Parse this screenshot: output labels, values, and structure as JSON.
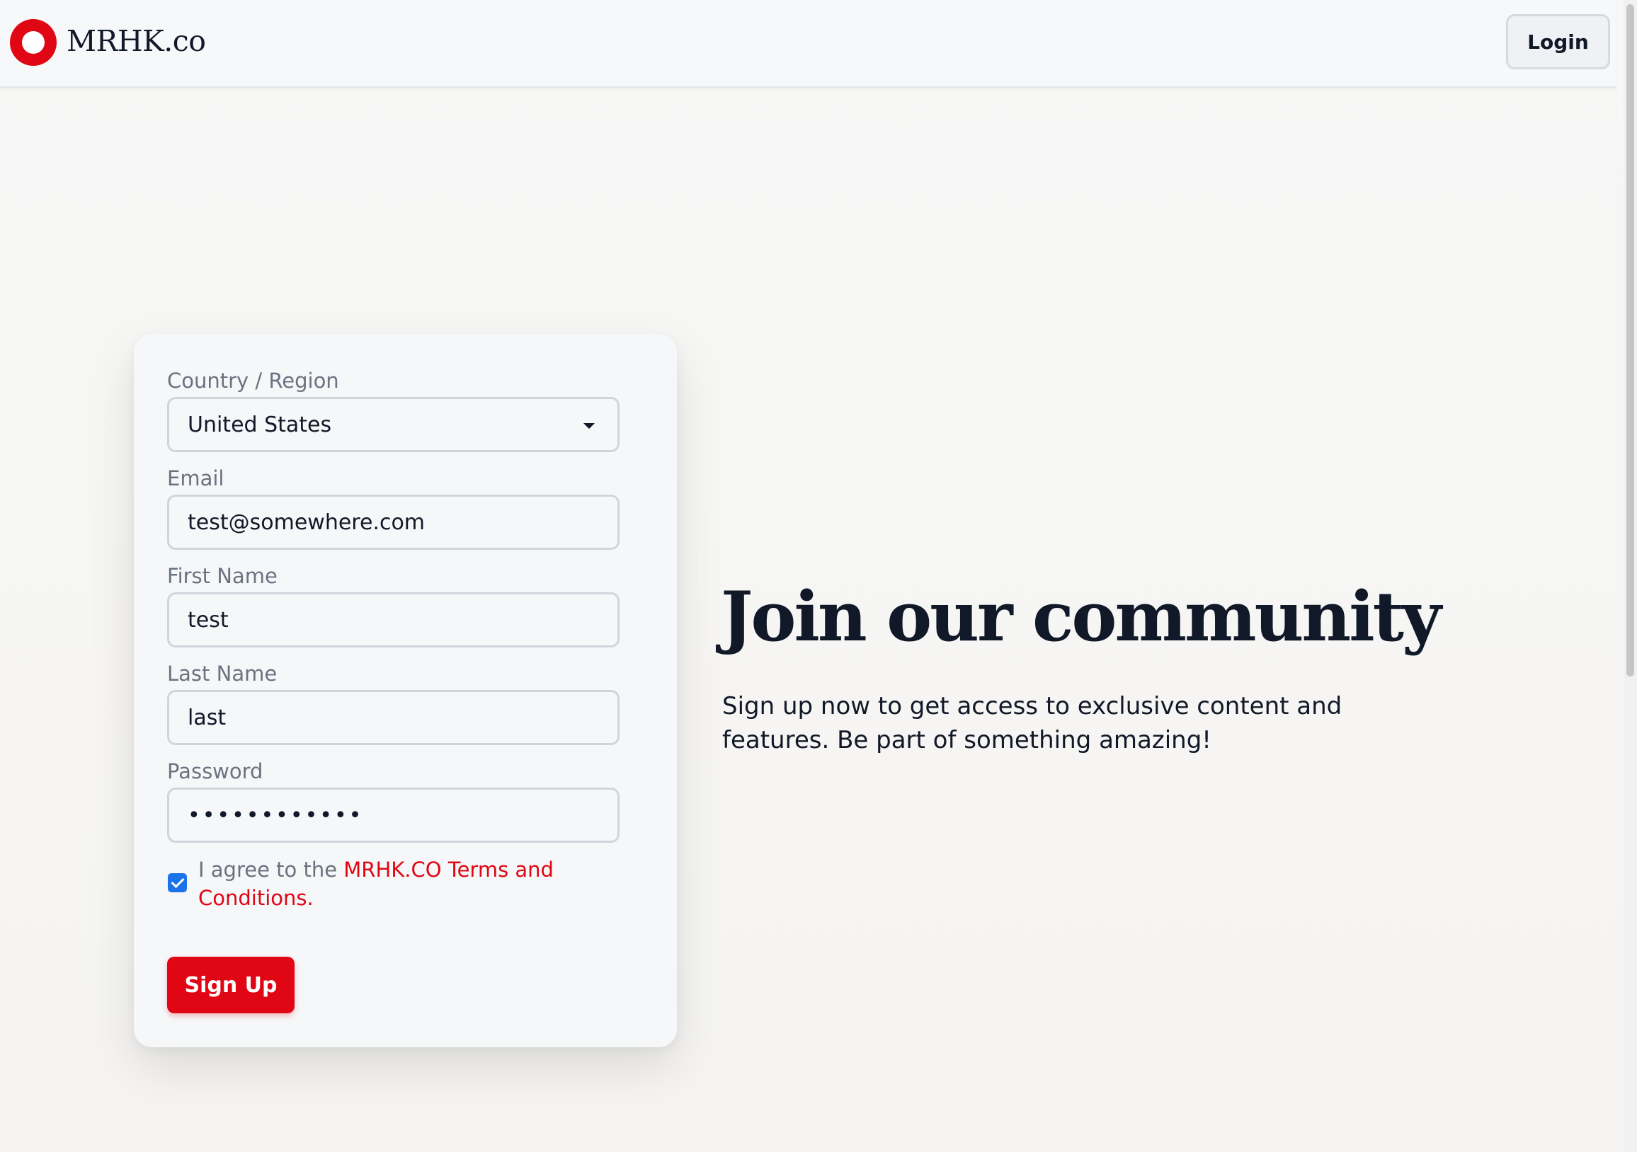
{
  "header": {
    "brand": "MRHK.co",
    "login_label": "Login"
  },
  "form": {
    "country": {
      "label": "Country / Region",
      "value": "United States"
    },
    "email": {
      "label": "Email",
      "value": "test@somewhere.com"
    },
    "first_name": {
      "label": "First Name",
      "value": "test"
    },
    "last_name": {
      "label": "Last Name",
      "value": "last"
    },
    "password": {
      "label": "Password",
      "masked_value": "••••••••••••"
    },
    "agree": {
      "checked": true,
      "prefix": "I agree to the ",
      "link_text": "MRHK.CO Terms and Conditions."
    },
    "submit_label": "Sign Up"
  },
  "hero": {
    "title": "Join our community",
    "description": "Sign up now to get access to exclusive content and features. Be part of something amazing!"
  },
  "colors": {
    "accent": "#e10613",
    "checkbox": "#1a73e8",
    "text": "#111827",
    "muted": "#6b7280"
  }
}
